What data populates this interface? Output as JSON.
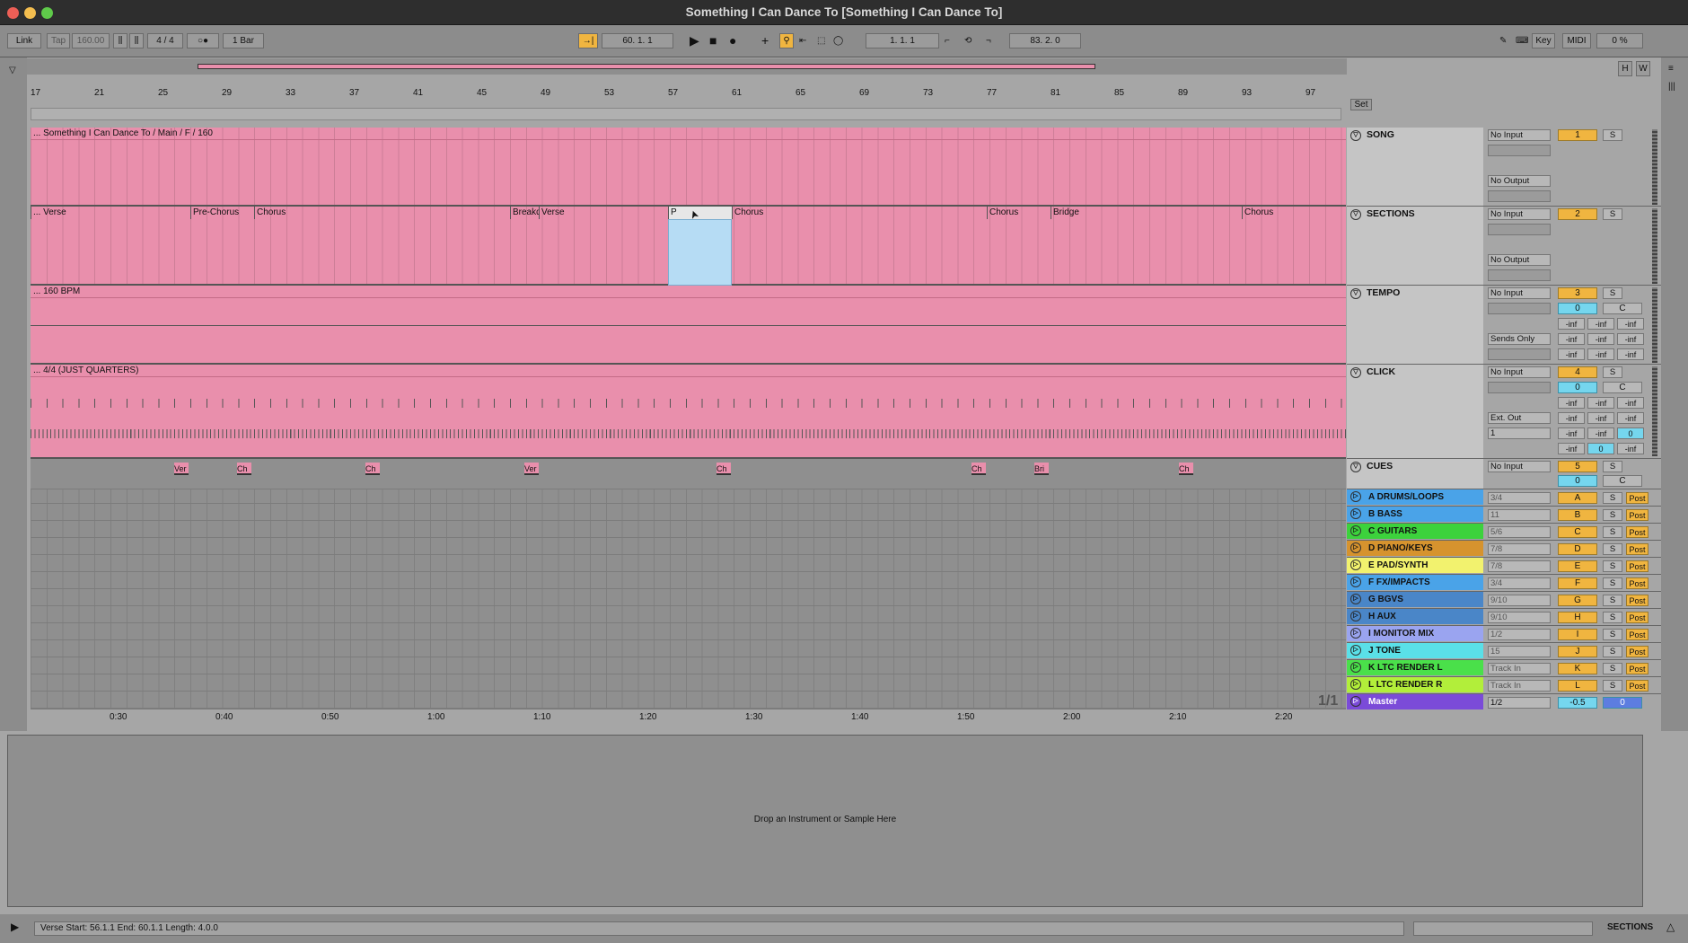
{
  "window": {
    "title": "Something I Can Dance To  [Something I Can Dance To]"
  },
  "toolbar": {
    "link": "Link",
    "tap": "Tap",
    "tempo": "160.00",
    "signature": "4 / 4",
    "metro": "○●",
    "quantize": "1 Bar",
    "arrangement_position": "60.   1.   1",
    "loop_start": "1.   1.   1",
    "loop_length": "83.   2.   0",
    "key": "Key",
    "midi": "MIDI",
    "cpu": "0 %"
  },
  "overview": {
    "h": "H",
    "w": "W"
  },
  "ruler": {
    "bars": [
      "17",
      "21",
      "25",
      "29",
      "33",
      "37",
      "41",
      "45",
      "49",
      "53",
      "57",
      "61",
      "65",
      "69",
      "73",
      "77",
      "81",
      "85",
      "89",
      "93",
      "97"
    ],
    "set": "Set"
  },
  "lanes": {
    "song_clip": "... Something I Can Dance To / Main / F / 160",
    "sections": [
      {
        "label": "... Verse"
      },
      {
        "label": "Pre-Chorus"
      },
      {
        "label": "Chorus"
      },
      {
        "label": "Breakdown"
      },
      {
        "label": "Verse"
      },
      {
        "label": "P"
      },
      {
        "label": "Chorus"
      },
      {
        "label": "Chorus"
      },
      {
        "label": "Bridge"
      },
      {
        "label": "Chorus"
      }
    ],
    "tempo_clip": "... 160 BPM",
    "click_clip": "... 4/4 (JUST QUARTERS)",
    "cues": [
      "Ver",
      "Ch",
      "Ch",
      "Ver",
      "Ch",
      "Ch",
      "Bri",
      "Ch"
    ]
  },
  "timeline": {
    "times": [
      "0:30",
      "0:40",
      "0:50",
      "1:00",
      "1:10",
      "1:20",
      "1:30",
      "1:40",
      "1:50",
      "2:00",
      "2:10",
      "2:20"
    ],
    "page": "1/1"
  },
  "tracks": {
    "song": {
      "name": "SONG",
      "input": "No Input",
      "output": "No Output",
      "num": "1",
      "solo": "S"
    },
    "sections": {
      "name": "SECTIONS",
      "input": "No Input",
      "output": "No Output",
      "num": "2",
      "solo": "S"
    },
    "tempo": {
      "name": "TEMPO",
      "input": "No Input",
      "output": "Sends Only",
      "num": "3",
      "solo": "S",
      "vol": "0",
      "pan": "C",
      "inf": "-inf"
    },
    "click": {
      "name": "CLICK",
      "input": "No Input",
      "output": "Ext. Out",
      "channel": "1",
      "num": "4",
      "solo": "S",
      "vol": "0",
      "pan": "C",
      "inf": "-inf",
      "zero": "0"
    },
    "cues": {
      "name": "CUES",
      "input": "No Input",
      "num": "5",
      "solo": "S",
      "vol": "0",
      "pan": "C"
    },
    "groups": [
      {
        "name": "A DRUMS/LOOPS",
        "io": "3/4",
        "letter": "A",
        "color": "#4aa3e8"
      },
      {
        "name": "B BASS",
        "io": "11",
        "letter": "B",
        "color": "#4aa3e8"
      },
      {
        "name": "C GUITARS",
        "io": "5/6",
        "letter": "C",
        "color": "#3cd23c"
      },
      {
        "name": "D PIANO/KEYS",
        "io": "7/8",
        "letter": "D",
        "color": "#d6932e"
      },
      {
        "name": "E PAD/SYNTH",
        "io": "7/8",
        "letter": "E",
        "color": "#f2f26e"
      },
      {
        "name": "F FX/IMPACTS",
        "io": "3/4",
        "letter": "F",
        "color": "#4aa3e8"
      },
      {
        "name": "G BGVS",
        "io": "9/10",
        "letter": "G",
        "color": "#4a86c8"
      },
      {
        "name": "H AUX",
        "io": "9/10",
        "letter": "H",
        "color": "#4a86c8"
      },
      {
        "name": "I MONITOR MIX",
        "io": "1/2",
        "letter": "I",
        "color": "#9aa4f0"
      },
      {
        "name": "J TONE",
        "io": "15",
        "letter": "J",
        "color": "#5ae0e8"
      },
      {
        "name": "K LTC RENDER L",
        "io": "Track In",
        "letter": "K",
        "color": "#4ae04a"
      },
      {
        "name": "L LTC RENDER R",
        "io": "Track In",
        "letter": "L",
        "color": "#b2ee3a"
      }
    ],
    "master": {
      "name": "Master",
      "io": "1/2",
      "vol": "-0.5",
      "pan": "0",
      "color": "#7b4bd8"
    },
    "solo": "S",
    "post": "Post"
  },
  "detail": {
    "message": "Drop an Instrument or Sample Here"
  },
  "status": {
    "text": "Verse  Start: 56.1.1  End: 60.1.1  Length: 4.0.0",
    "view": "SECTIONS"
  }
}
